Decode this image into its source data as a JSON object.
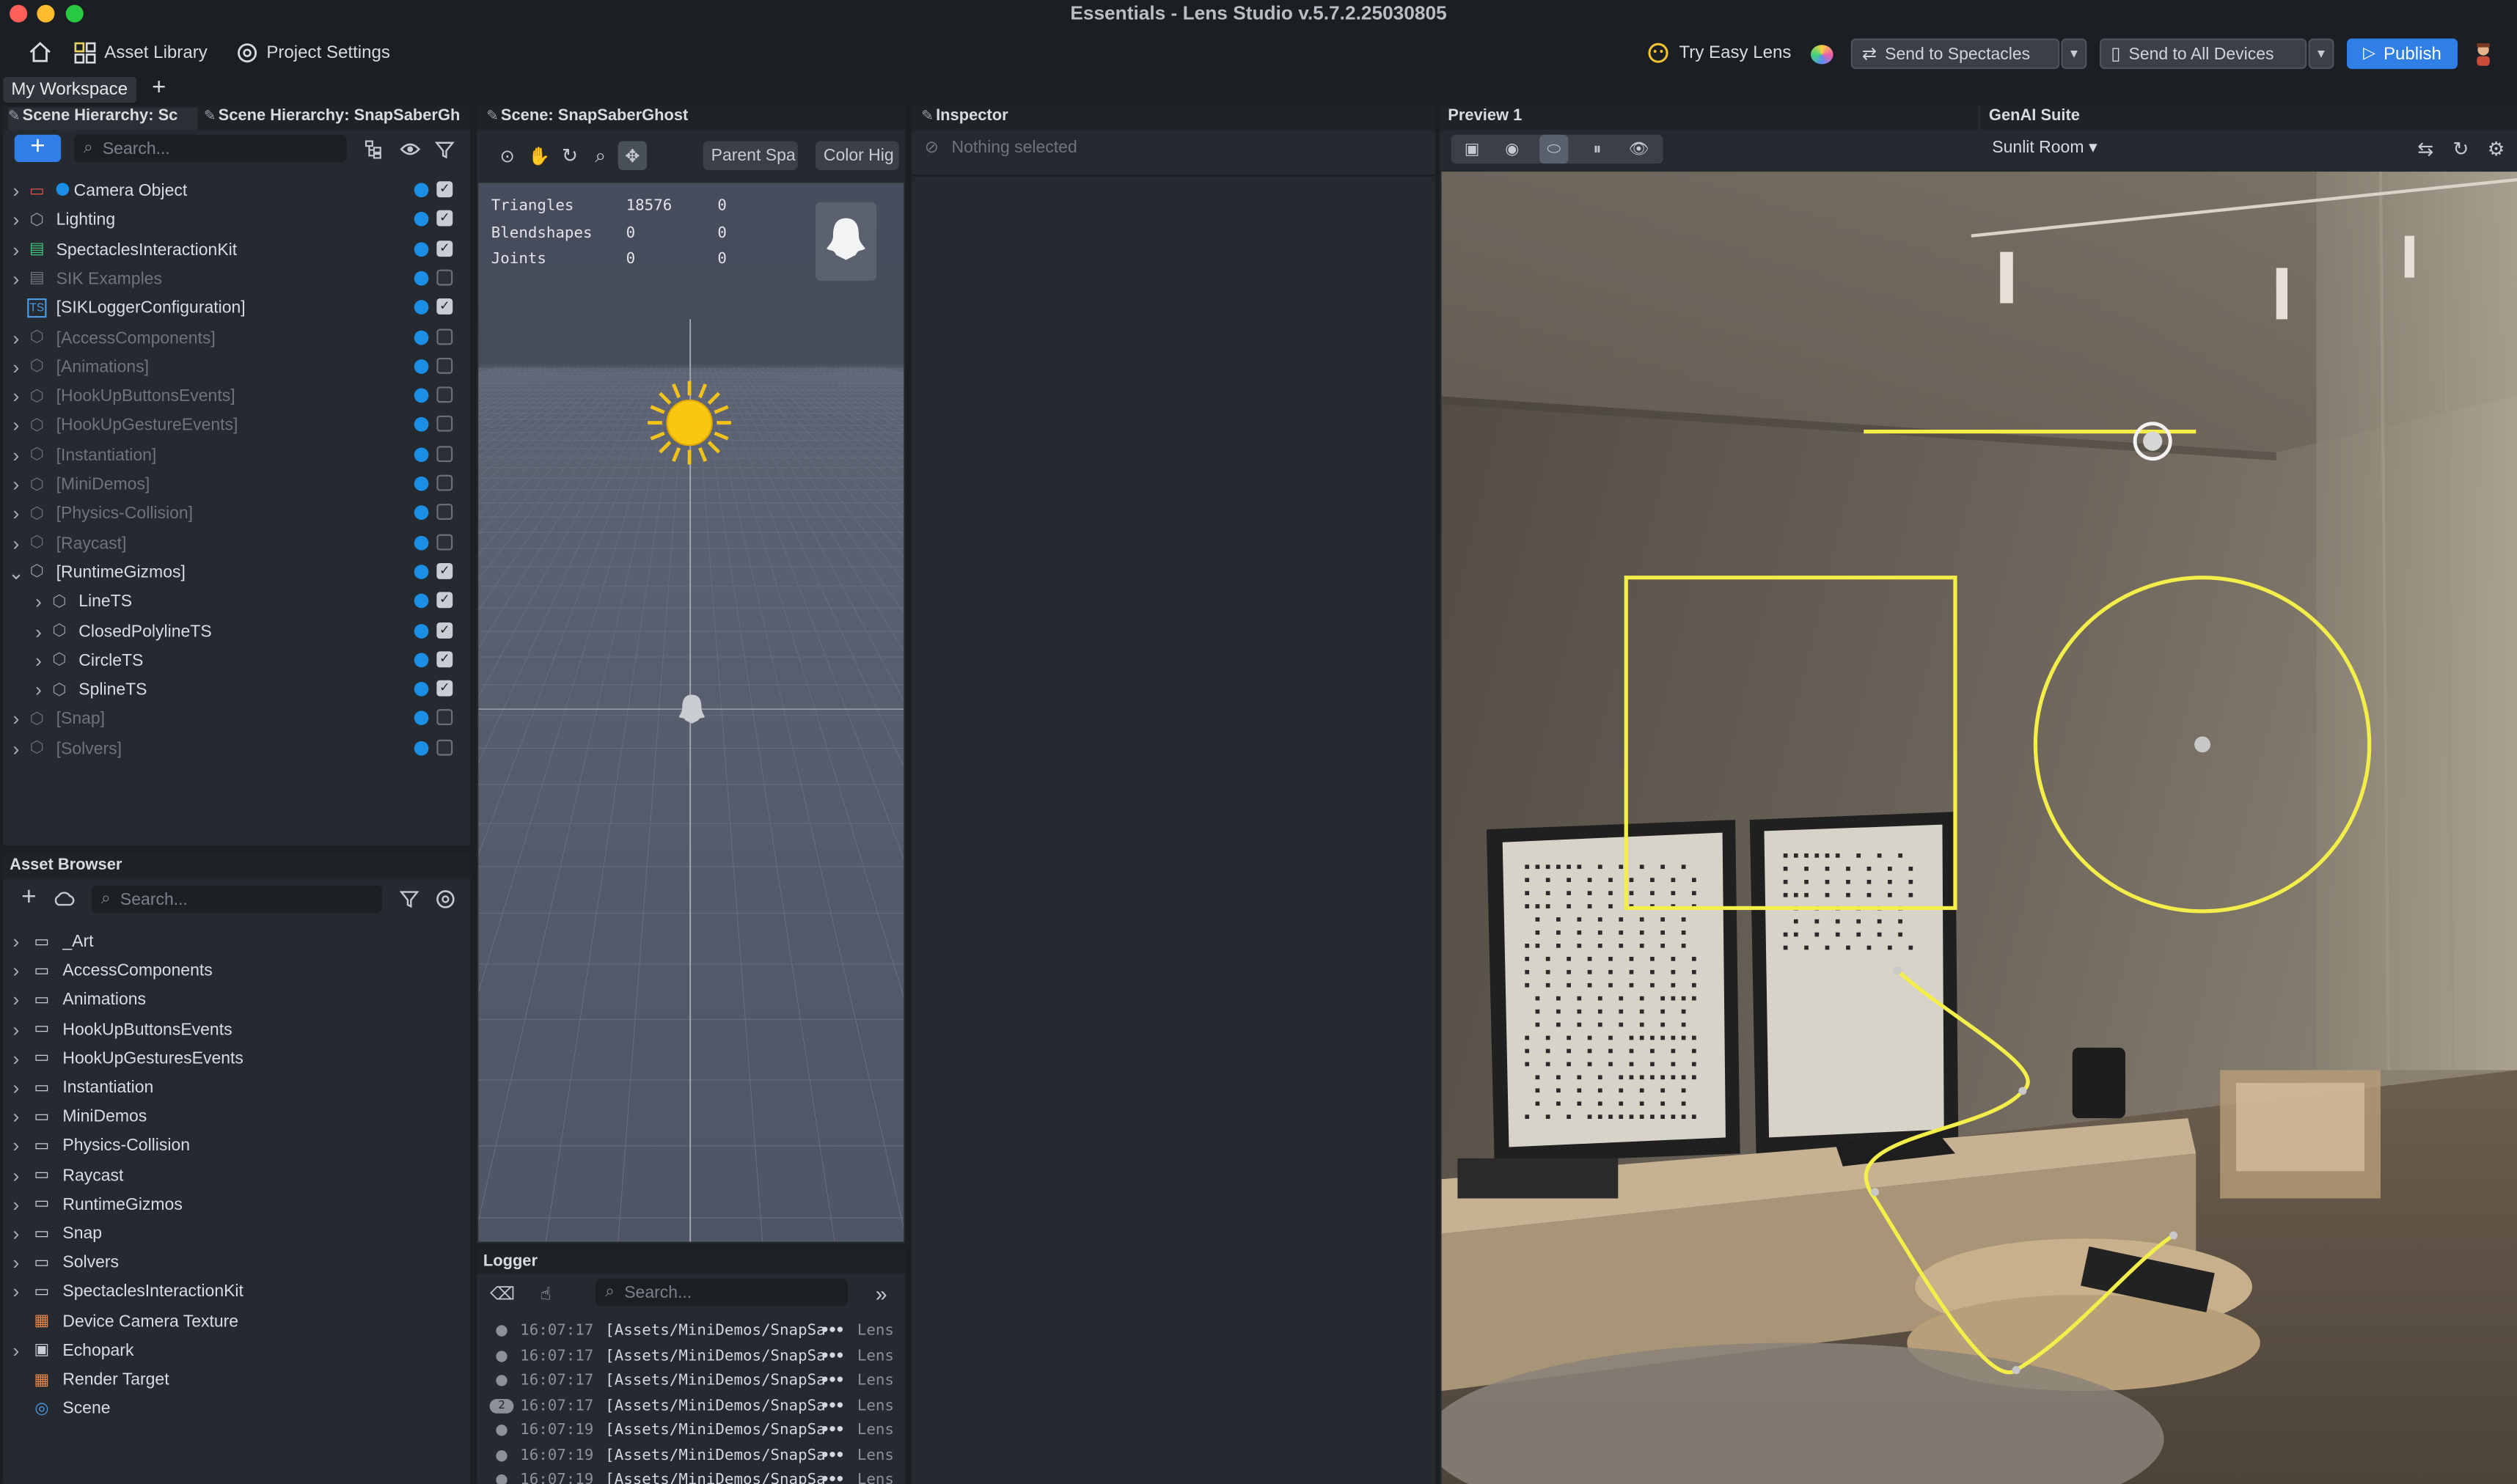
{
  "window": {
    "title": "Essentials - Lens Studio v.5.7.2.25030805"
  },
  "toolbar": {
    "asset_library": "Asset Library",
    "project_settings": "Project Settings",
    "try_easy_lens": "Try Easy Lens",
    "send_to_spectacles": "Send to Spectacles",
    "send_to_all_devices": "Send to All Devices",
    "publish": "Publish"
  },
  "workspace": {
    "tab": "My Workspace"
  },
  "scene_hierarchy": {
    "tab1": "Scene Hierarchy: Sc",
    "tab2": "Scene Hierarchy: SnapSaberGh",
    "search_placeholder": "Search...",
    "items": [
      {
        "label": "Camera Object",
        "icon": "camera-icon",
        "visible": true,
        "checked": true,
        "enabled": true,
        "indent": 0,
        "expanded": false
      },
      {
        "label": "Lighting",
        "icon": "scene-object-icon",
        "visible": true,
        "checked": true,
        "enabled": true,
        "indent": 0,
        "expanded": false
      },
      {
        "label": "SpectaclesInteractionKit",
        "icon": "prefab-icon",
        "visible": true,
        "checked": true,
        "enabled": true,
        "indent": 0,
        "expanded": false
      },
      {
        "label": "SIK Examples",
        "icon": "prefab-icon",
        "visible": true,
        "checked": false,
        "enabled": false,
        "indent": 0,
        "expanded": false
      },
      {
        "label": "[SIKLoggerConfiguration]",
        "icon": "script-icon",
        "visible": true,
        "checked": true,
        "enabled": true,
        "indent": 0,
        "expanded": null
      },
      {
        "label": "[AccessComponents]",
        "icon": "scene-object-icon",
        "visible": true,
        "checked": false,
        "enabled": false,
        "indent": 0,
        "expanded": false
      },
      {
        "label": "[Animations]",
        "icon": "scene-object-icon",
        "visible": true,
        "checked": false,
        "enabled": false,
        "indent": 0,
        "expanded": false
      },
      {
        "label": "[HookUpButtonsEvents]",
        "icon": "scene-object-icon",
        "visible": true,
        "checked": false,
        "enabled": false,
        "indent": 0,
        "expanded": false
      },
      {
        "label": "[HookUpGestureEvents]",
        "icon": "scene-object-icon",
        "visible": true,
        "checked": false,
        "enabled": false,
        "indent": 0,
        "expanded": false
      },
      {
        "label": "[Instantiation]",
        "icon": "scene-object-icon",
        "visible": true,
        "checked": false,
        "enabled": false,
        "indent": 0,
        "expanded": false
      },
      {
        "label": "[MiniDemos]",
        "icon": "scene-object-icon",
        "visible": true,
        "checked": false,
        "enabled": false,
        "indent": 0,
        "expanded": false
      },
      {
        "label": "[Physics-Collision]",
        "icon": "scene-object-icon",
        "visible": true,
        "checked": false,
        "enabled": false,
        "indent": 0,
        "expanded": false
      },
      {
        "label": "[Raycast]",
        "icon": "scene-object-icon",
        "visible": true,
        "checked": false,
        "enabled": false,
        "indent": 0,
        "expanded": false
      },
      {
        "label": "[RuntimeGizmos]",
        "icon": "scene-object-icon",
        "visible": true,
        "checked": true,
        "enabled": true,
        "indent": 0,
        "expanded": true
      },
      {
        "label": "LineTS",
        "icon": "scene-object-icon",
        "visible": true,
        "checked": true,
        "enabled": true,
        "indent": 1,
        "expanded": false
      },
      {
        "label": "ClosedPolylineTS",
        "icon": "scene-object-icon",
        "visible": true,
        "checked": true,
        "enabled": true,
        "indent": 1,
        "expanded": false
      },
      {
        "label": "CircleTS",
        "icon": "scene-object-icon",
        "visible": true,
        "checked": true,
        "enabled": true,
        "indent": 1,
        "expanded": false
      },
      {
        "label": "SplineTS",
        "icon": "scene-object-icon",
        "visible": true,
        "checked": true,
        "enabled": true,
        "indent": 1,
        "expanded": false
      },
      {
        "label": "[Snap]",
        "icon": "scene-object-icon",
        "visible": true,
        "checked": false,
        "enabled": false,
        "indent": 0,
        "expanded": false
      },
      {
        "label": "[Solvers]",
        "icon": "scene-object-icon",
        "visible": true,
        "checked": false,
        "enabled": false,
        "indent": 0,
        "expanded": false
      }
    ]
  },
  "asset_browser": {
    "title": "Asset Browser",
    "search_placeholder": "Search...",
    "items": [
      {
        "label": "_Art",
        "icon": "folder-icon",
        "chevron": true
      },
      {
        "label": "AccessComponents",
        "icon": "folder-icon",
        "chevron": true
      },
      {
        "label": "Animations",
        "icon": "folder-icon",
        "chevron": true
      },
      {
        "label": "HookUpButtonsEvents",
        "icon": "folder-icon",
        "chevron": true
      },
      {
        "label": "HookUpGesturesEvents",
        "icon": "folder-icon",
        "chevron": true
      },
      {
        "label": "Instantiation",
        "icon": "folder-icon",
        "chevron": true
      },
      {
        "label": "MiniDemos",
        "icon": "folder-icon",
        "chevron": true
      },
      {
        "label": "Physics-Collision",
        "icon": "folder-icon",
        "chevron": true
      },
      {
        "label": "Raycast",
        "icon": "folder-icon",
        "chevron": true
      },
      {
        "label": "RuntimeGizmos",
        "icon": "folder-icon",
        "chevron": true
      },
      {
        "label": "Snap",
        "icon": "folder-icon",
        "chevron": true
      },
      {
        "label": "Solvers",
        "icon": "folder-icon",
        "chevron": true
      },
      {
        "label": "SpectaclesInteractionKit",
        "icon": "folder-icon",
        "chevron": true
      },
      {
        "label": "Device Camera Texture",
        "icon": "texture-icon",
        "chevron": false
      },
      {
        "label": "Echopark",
        "icon": "mesh-icon",
        "chevron": true
      },
      {
        "label": "Render Target",
        "icon": "texture-icon",
        "chevron": false
      },
      {
        "label": "Scene",
        "icon": "scene-icon",
        "chevron": false
      }
    ]
  },
  "scene_view": {
    "title": "Scene: SnapSaberGhost",
    "parent_space": "Parent Spa",
    "color_highlight": "Color Hig",
    "stats": [
      {
        "name": "Triangles",
        "a": "18576",
        "b": "0"
      },
      {
        "name": "Blendshapes",
        "a": "0",
        "b": "0"
      },
      {
        "name": "Joints",
        "a": "0",
        "b": "0"
      }
    ]
  },
  "logger": {
    "title": "Logger",
    "search_placeholder": "Search...",
    "rows": [
      {
        "time": "16:07:17",
        "path": "[Assets/MiniDemos/SnapSa",
        "source": "Lens",
        "count": ""
      },
      {
        "time": "16:07:17",
        "path": "[Assets/MiniDemos/SnapSa",
        "source": "Lens",
        "count": ""
      },
      {
        "time": "16:07:17",
        "path": "[Assets/MiniDemos/SnapSa",
        "source": "Lens",
        "count": ""
      },
      {
        "time": "16:07:17",
        "path": "[Assets/MiniDemos/SnapSa",
        "source": "Lens",
        "count": "2"
      },
      {
        "time": "16:07:19",
        "path": "[Assets/MiniDemos/SnapSa",
        "source": "Lens",
        "count": ""
      },
      {
        "time": "16:07:19",
        "path": "[Assets/MiniDemos/SnapSa",
        "source": "Lens",
        "count": ""
      },
      {
        "time": "16:07:19",
        "path": "[Assets/MiniDemos/SnapSa",
        "source": "Lens",
        "count": ""
      }
    ]
  },
  "inspector": {
    "title": "Inspector",
    "empty": "Nothing selected"
  },
  "preview": {
    "title": "Preview 1"
  },
  "genai": {
    "title": "GenAI Suite",
    "environment": "Sunlit Room"
  },
  "colors": {
    "accent": "#2f7fe6",
    "gizmo": "#f4ee4a",
    "panel": "#252930",
    "toolbar": "#1b1e23"
  }
}
